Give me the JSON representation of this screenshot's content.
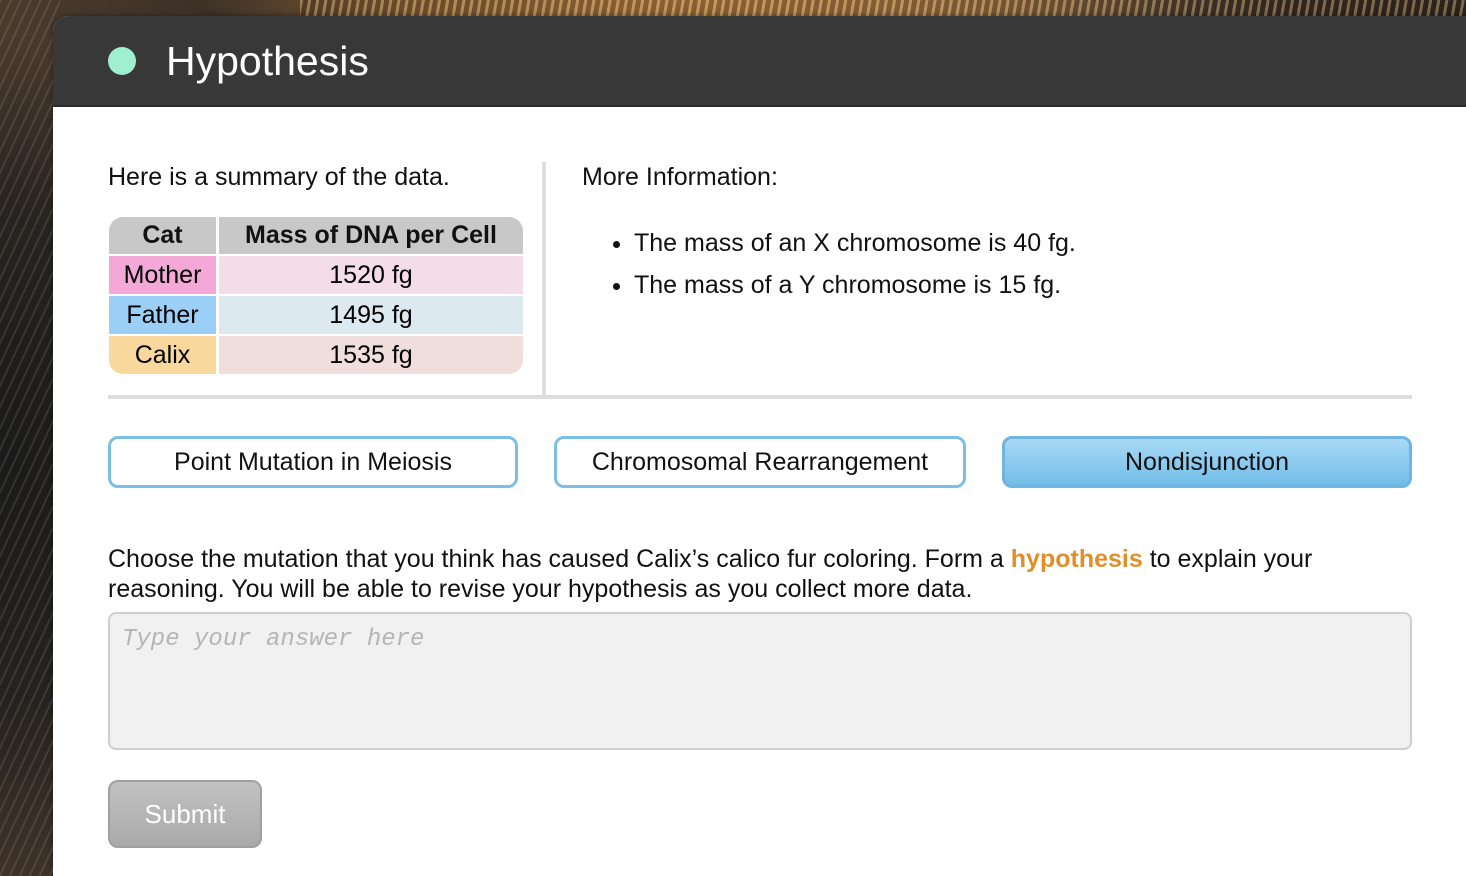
{
  "header": {
    "title": "Hypothesis",
    "status_color": "#9ef0d0"
  },
  "summary": {
    "intro": "Here is a summary of the data.",
    "table": {
      "headers": [
        "Cat",
        "Mass of DNA per Cell"
      ],
      "rows": [
        {
          "cat": "Mother",
          "mass": "1520 fg",
          "label_color": "#f3a8d8",
          "value_color": "#f2dde9"
        },
        {
          "cat": "Father",
          "mass": "1495 fg",
          "label_color": "#9ccff5",
          "value_color": "#dde9f0"
        },
        {
          "cat": "Calix",
          "mass": "1535 fg",
          "label_color": "#f8d89c",
          "value_color": "#f0dedc"
        }
      ]
    }
  },
  "more_info": {
    "title": "More Information:",
    "items": [
      "The mass of an X chromosome is 40 fg.",
      "The mass of a Y chromosome is 15 fg."
    ]
  },
  "choices": {
    "options": [
      {
        "label": "Point Mutation in Meiosis",
        "selected": false
      },
      {
        "label": "Chromosomal Rearrangement",
        "selected": false
      },
      {
        "label": "Nondisjunction",
        "selected": true
      }
    ]
  },
  "prompt": {
    "before": "Choose the mutation that you think has caused Calix’s calico fur coloring. Form a ",
    "keyword": "hypothesis",
    "after": " to explain your reasoning. You will be able to revise your hypothesis as you collect more data.",
    "keyword_color": "#e08f2a"
  },
  "answer": {
    "value": "",
    "placeholder": "Type your answer here"
  },
  "submit": {
    "label": "Submit"
  }
}
